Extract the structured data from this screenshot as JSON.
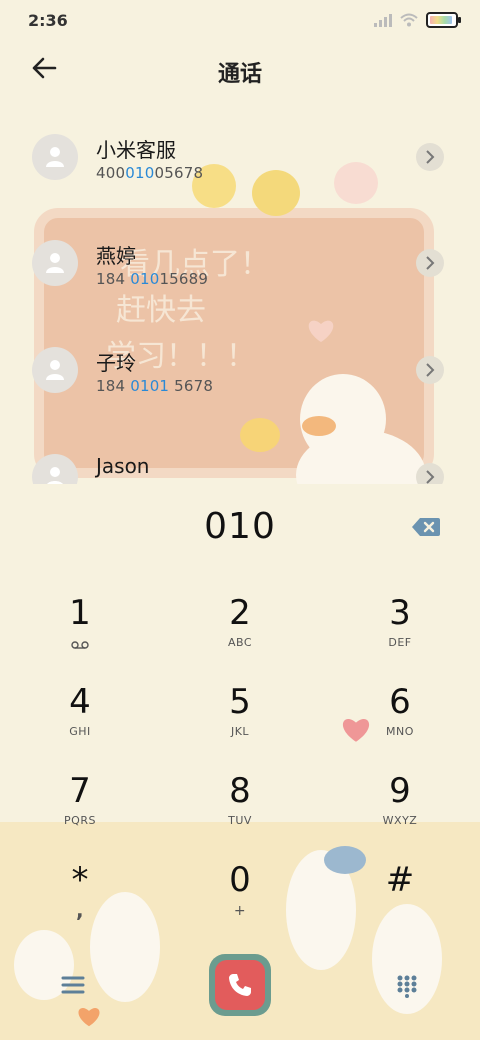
{
  "status": {
    "time": "2:36"
  },
  "header": {
    "title": "通话"
  },
  "contacts": [
    {
      "name": "小米客服",
      "num_pre": "400",
      "num_hl": "010",
      "num_post": "05678"
    },
    {
      "name": "燕婷",
      "num_pre": "184 ",
      "num_hl": "010",
      "num_post": "15689"
    },
    {
      "name": "子玲",
      "num_pre": "184 ",
      "num_hl": "0101",
      "num_post": " 5678"
    },
    {
      "name": "Jason",
      "num_pre": "",
      "num_hl": "",
      "num_post": ""
    }
  ],
  "wallpaper_text": [
    "看几点了！",
    "赶快去",
    "学习！！！"
  ],
  "dial": {
    "input": "010"
  },
  "keys": [
    {
      "digit": "1",
      "letters": ""
    },
    {
      "digit": "2",
      "letters": "ABC"
    },
    {
      "digit": "3",
      "letters": "DEF"
    },
    {
      "digit": "4",
      "letters": "GHI"
    },
    {
      "digit": "5",
      "letters": "JKL"
    },
    {
      "digit": "6",
      "letters": "MNO"
    },
    {
      "digit": "7",
      "letters": "PQRS"
    },
    {
      "digit": "8",
      "letters": "TUV"
    },
    {
      "digit": "9",
      "letters": "WXYZ"
    },
    {
      "digit": "*",
      "letters": ","
    },
    {
      "digit": "0",
      "letters": "+"
    },
    {
      "digit": "#",
      "letters": ""
    }
  ],
  "colors": {
    "background": "#f7f2df",
    "highlight": "#2a89d6",
    "call_button": "#e25c5c",
    "call_frame": "#6b9c8f"
  },
  "icons": {
    "back": "arrow-left-icon",
    "contact_avatar": "person-icon",
    "contact_detail": "chevron-right-icon",
    "backspace": "backspace-icon",
    "voicemail": "voicemail-icon",
    "menu": "menu-icon",
    "call": "phone-icon",
    "keypad": "keypad-icon"
  }
}
